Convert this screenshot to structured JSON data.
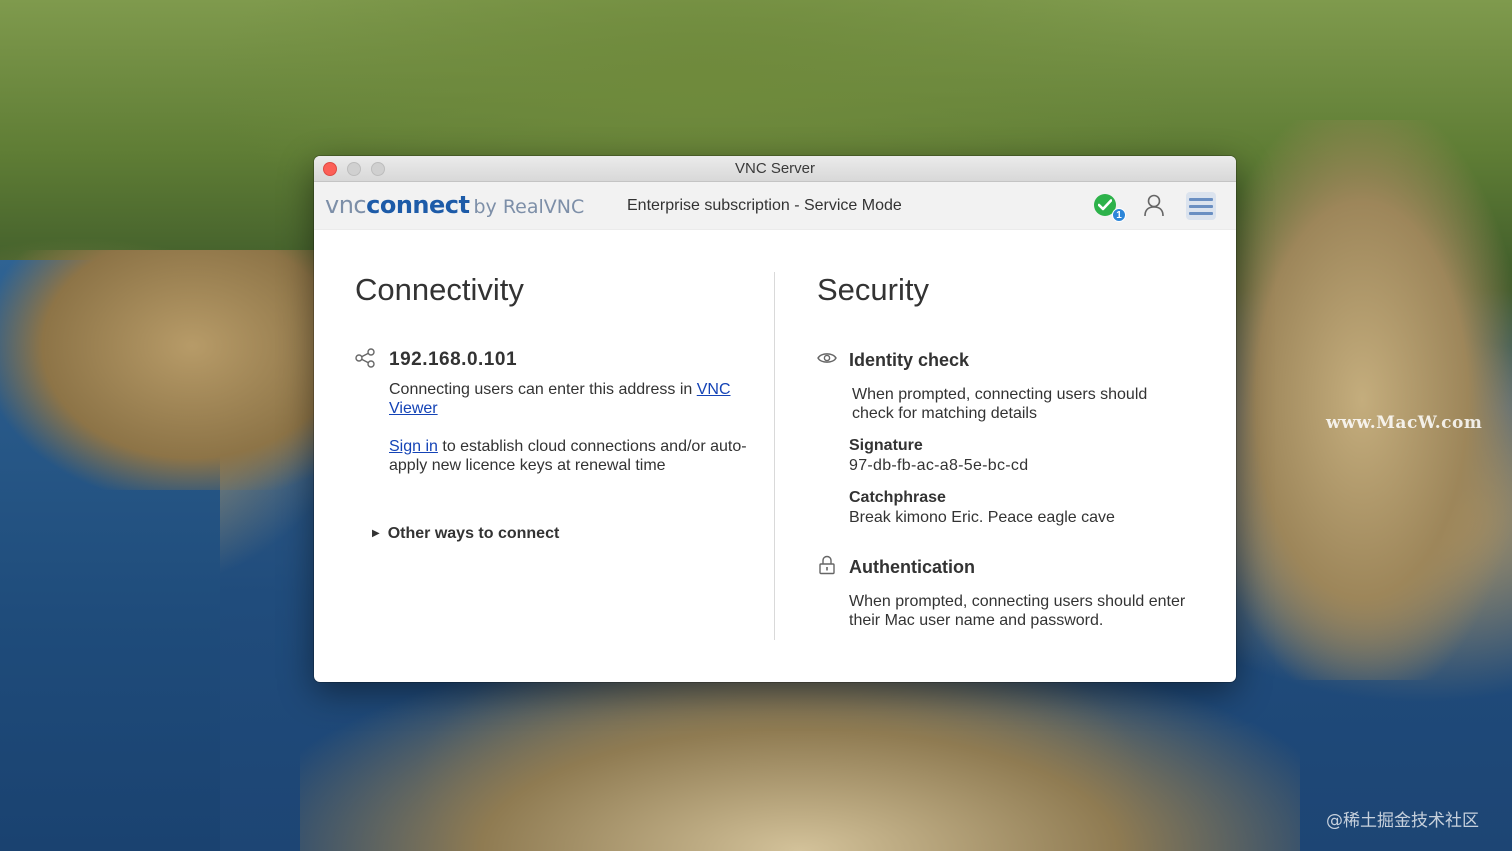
{
  "window": {
    "title": "VNC Server"
  },
  "toolbar": {
    "logo_vnc": "vnc",
    "logo_connect": "connect",
    "logo_by": "by RealVNC",
    "subscription": "Enterprise subscription - Service Mode",
    "status_badge_count": "1",
    "status_color": "#2db24a",
    "icons": [
      "check-circle-icon",
      "user-icon",
      "hamburger-menu-icon"
    ]
  },
  "connectivity": {
    "title": "Connectivity",
    "ip_address": "192.168.0.101",
    "desc_prefix": "Connecting users can enter this address in ",
    "desc_link": "VNC Viewer",
    "signin_link": "Sign in",
    "signin_suffix": " to establish cloud connections and/or auto-apply new licence keys at renewal time",
    "other_ways": "Other ways to connect"
  },
  "security": {
    "title": "Security",
    "identity_heading": "Identity check",
    "identity_desc": "When prompted, connecting users should check for matching details",
    "signature_label": "Signature",
    "signature_value": "97-db-fb-ac-a8-5e-bc-cd",
    "catchphrase_label": "Catchphrase",
    "catchphrase_value": "Break kimono Eric. Peace eagle cave",
    "auth_heading": "Authentication",
    "auth_desc": "When prompted, connecting users should enter their Mac user name and password."
  },
  "desktop": {
    "watermark_1": "www.MacW.com",
    "watermark_2": "@稀土掘金技术社区"
  },
  "colors": {
    "link": "#1443b6",
    "brand_blue": "#1d5ba8"
  }
}
